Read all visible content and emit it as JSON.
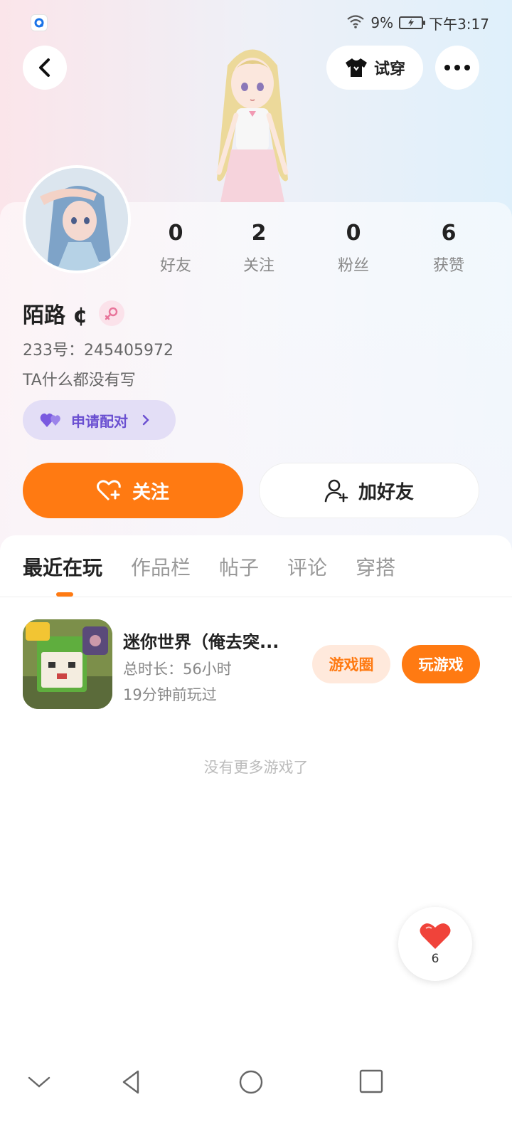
{
  "status_bar": {
    "battery": "9%",
    "time": "下午3:17"
  },
  "header": {
    "tryon_label": "试穿"
  },
  "profile": {
    "nickname": "陌路 ¢",
    "id_line": "233号：245405972",
    "bio": "TA什么都没有写",
    "pair_label": "申请配对",
    "stats": [
      {
        "value": "0",
        "label": "好友"
      },
      {
        "value": "2",
        "label": "关注"
      },
      {
        "value": "0",
        "label": "粉丝"
      },
      {
        "value": "6",
        "label": "获赞"
      }
    ]
  },
  "actions": {
    "follow_label": "关注",
    "add_friend_label": "加好友"
  },
  "tabs": [
    "最近在玩",
    "作品栏",
    "帖子",
    "评论",
    "穿搭"
  ],
  "recent_game": {
    "name": "迷你世界（俺去突...",
    "duration": "总时长：56小时",
    "last_played": "19分钟前玩过",
    "circle_label": "游戏圈",
    "play_label": "玩游戏"
  },
  "no_more_text": "没有更多游戏了",
  "like_float": {
    "count": "6"
  },
  "colors": {
    "accent": "#ff7a12",
    "pair": "#6a4fd1",
    "gender": "#e8749a"
  }
}
